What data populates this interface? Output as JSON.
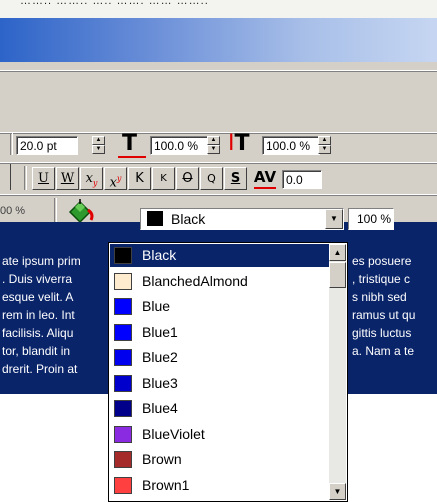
{
  "topstrip_text": "…….. …….. ….. ……. …… ……..",
  "toolbar1": {
    "font_size": "20.0 pt",
    "horiz_scale": "100.0 %",
    "vert_scale": "100.0 %"
  },
  "toolbar2": {
    "buttons": [
      "U",
      "W",
      "x",
      "x",
      "K",
      "K",
      "O",
      "Q",
      "S",
      "AV"
    ],
    "tracking_value": "0.0"
  },
  "toolbar3": {
    "left_percent": "00 %",
    "color_selected": "Black",
    "tint_percent": "100 %"
  },
  "editor_lines": [
    "ate ipsum prim",
    ". Duis viverra",
    "esque velit. A",
    "rem in leo. Int",
    "facilisis. Aliqu",
    "tor, blandit in",
    "drerit. Proin at"
  ],
  "editor_lines_right": [
    "es posuere",
    ", tristique c",
    "s nibh sed",
    "ramus ut qu",
    "gittis luctus",
    "a. Nam a te",
    ""
  ],
  "colors": [
    {
      "name": "Black",
      "hex": "#000000",
      "selected": true
    },
    {
      "name": "BlanchedAlmond",
      "hex": "#ffebcd"
    },
    {
      "name": "Blue",
      "hex": "#0000ff"
    },
    {
      "name": "Blue1",
      "hex": "#0000ff"
    },
    {
      "name": "Blue2",
      "hex": "#0000ee"
    },
    {
      "name": "Blue3",
      "hex": "#0000cd"
    },
    {
      "name": "Blue4",
      "hex": "#00008b"
    },
    {
      "name": "BlueViolet",
      "hex": "#8a2be2"
    },
    {
      "name": "Brown",
      "hex": "#a52a2a"
    },
    {
      "name": "Brown1",
      "hex": "#ff4040"
    }
  ]
}
